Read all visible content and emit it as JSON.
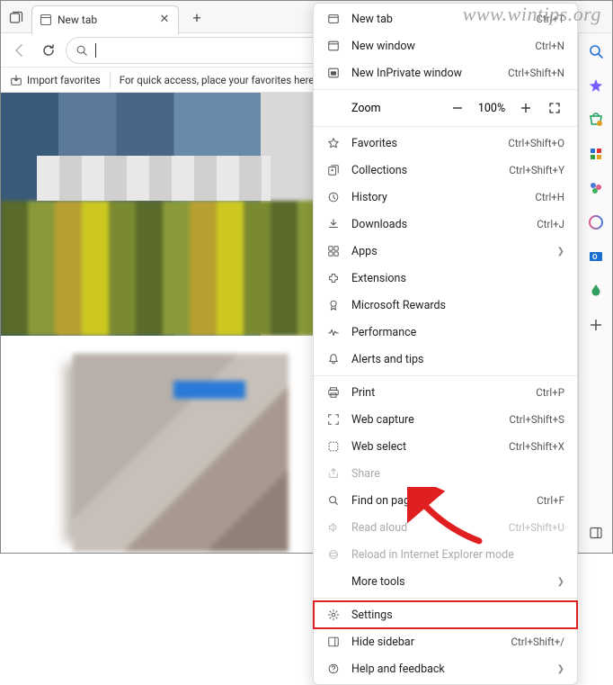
{
  "watermark": "www.wintips.org",
  "tab": {
    "title": "New tab"
  },
  "favbar": {
    "import": "Import favorites",
    "hint": "For quick access, place your favorites here on the favorites bar."
  },
  "zoom": {
    "label": "Zoom",
    "value": "100%"
  },
  "menu": {
    "new_tab": {
      "label": "New tab",
      "shortcut": "Ctrl+T"
    },
    "new_window": {
      "label": "New window",
      "shortcut": "Ctrl+N"
    },
    "new_inprivate": {
      "label": "New InPrivate window",
      "shortcut": "Ctrl+Shift+N"
    },
    "favorites": {
      "label": "Favorites",
      "shortcut": "Ctrl+Shift+O"
    },
    "collections": {
      "label": "Collections",
      "shortcut": "Ctrl+Shift+Y"
    },
    "history": {
      "label": "History",
      "shortcut": "Ctrl+H"
    },
    "downloads": {
      "label": "Downloads",
      "shortcut": "Ctrl+J"
    },
    "apps": {
      "label": "Apps"
    },
    "extensions": {
      "label": "Extensions"
    },
    "rewards": {
      "label": "Microsoft Rewards"
    },
    "performance": {
      "label": "Performance"
    },
    "alerts": {
      "label": "Alerts and tips"
    },
    "print": {
      "label": "Print",
      "shortcut": "Ctrl+P"
    },
    "web_capture": {
      "label": "Web capture",
      "shortcut": "Ctrl+Shift+S"
    },
    "web_select": {
      "label": "Web select",
      "shortcut": "Ctrl+Shift+X"
    },
    "share": {
      "label": "Share"
    },
    "find": {
      "label": "Find on page",
      "shortcut": "Ctrl+F"
    },
    "read_aloud": {
      "label": "Read aloud",
      "shortcut": "Ctrl+Shift+U"
    },
    "reload_ie": {
      "label": "Reload in Internet Explorer mode"
    },
    "more_tools": {
      "label": "More tools"
    },
    "settings": {
      "label": "Settings"
    },
    "hide_sidebar": {
      "label": "Hide sidebar",
      "shortcut": "Ctrl+Shift+/"
    },
    "help": {
      "label": "Help and feedback"
    }
  }
}
